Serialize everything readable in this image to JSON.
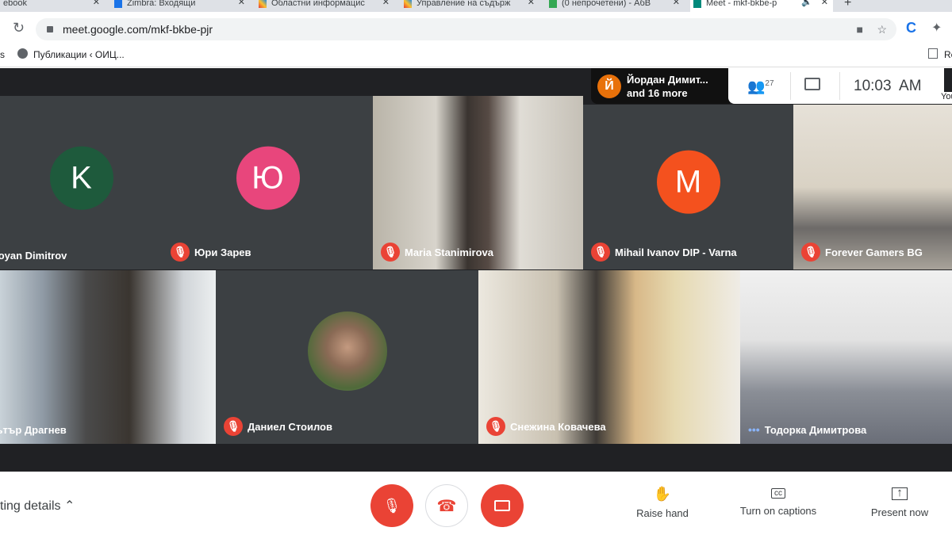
{
  "browser": {
    "tabs": [
      {
        "label": "ebook",
        "color": "#3b5998"
      },
      {
        "label": "Zimbra: Входящи",
        "color": "#1a73e8"
      },
      {
        "label": "Областни информацис",
        "color": "#e53935"
      },
      {
        "label": "Управление на съдърж",
        "color": "#e53935"
      },
      {
        "label": "(0 непрочетени) - АбВ",
        "color": "#34a853"
      },
      {
        "label": "Meet - mkf-bkbe-p",
        "color": "#00897b",
        "active": true
      }
    ],
    "new_tab": "+",
    "url": "meet.google.com/mkf-bkbe-pjr",
    "bookmarks": [
      {
        "label": "s"
      },
      {
        "label": "Публикации ‹ ОИЦ..."
      }
    ],
    "reading_list": "Re"
  },
  "meet": {
    "notification": {
      "initial": "Й",
      "name": "Йордан Димит...",
      "more": "and 16 more",
      "color": "#e8710a"
    },
    "participants_count": "27",
    "clock": "10:03  AM",
    "you_label": "You",
    "tiles": [
      {
        "name": "Yoyan Dimitrov",
        "initial": "K",
        "color": "#1e5a3c",
        "muted": false
      },
      {
        "name": "Юри Зарев",
        "initial": "Ю",
        "color": "#e8467c",
        "muted": true
      },
      {
        "name": "Maria Stanimirova",
        "video": true,
        "muted": true
      },
      {
        "name": "Mihail Ivanov DIP - Varna",
        "initial": "M",
        "color": "#f4511e",
        "muted": true
      },
      {
        "name": "Forever Gamers BG",
        "video": true,
        "muted": true
      },
      {
        "name": "ътър Драгнев",
        "video": true,
        "muted": false
      },
      {
        "name": "Даниел Стоилов",
        "photo": true,
        "muted": true
      },
      {
        "name": "Снежина Ковачева",
        "video": true,
        "muted": true
      },
      {
        "name": "Тодорка Димитрова",
        "video": true,
        "speaking": true
      }
    ],
    "bottom": {
      "meeting_details": "ting details",
      "raise_hand": "Raise hand",
      "captions": "Turn on captions",
      "present": "Present now"
    },
    "accent_red": "#ea4335"
  }
}
